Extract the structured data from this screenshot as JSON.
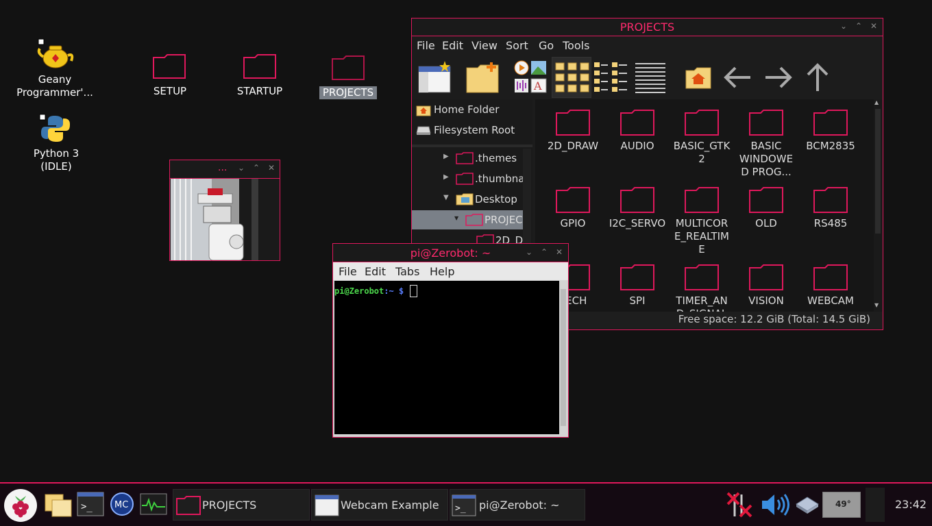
{
  "desktop": {
    "icons": [
      {
        "label": "Geany\nProgrammer'...",
        "icon": "geany-teapot-icon"
      },
      {
        "label": "Python 3\n(IDLE)",
        "icon": "python-icon"
      },
      {
        "label": "SETUP",
        "icon": "folder-icon"
      },
      {
        "label": "STARTUP",
        "icon": "folder-icon"
      },
      {
        "label": "PROJECTS",
        "icon": "folder-icon"
      }
    ]
  },
  "webcam_window": {
    "title": "...",
    "image": "webcam-feed-robot"
  },
  "file_manager": {
    "title": "PROJECTS",
    "menu": [
      "File",
      "Edit",
      "View",
      "Sort",
      "Go",
      "Tools"
    ],
    "toolbar": [
      "new-window-icon",
      "new-folder-icon",
      "thumbnail-view-icon",
      "icon-view-icon",
      "compact-view-icon",
      "detailed-list-icon",
      "home-icon",
      "back-arrow-icon",
      "forward-arrow-icon",
      "up-arrow-icon"
    ],
    "places": [
      {
        "label": "Home Folder",
        "icon": "home-icon"
      },
      {
        "label": "Filesystem Root",
        "icon": "drive-icon"
      }
    ],
    "tree": [
      {
        "label": ".themes",
        "expander": "▶"
      },
      {
        "label": ".thumbna",
        "expander": "▶"
      },
      {
        "label": "Desktop",
        "expander": "▼"
      },
      {
        "label": "PROJEC",
        "expander": "▼"
      },
      {
        "label": "2D_D",
        "expander": ""
      }
    ],
    "items": [
      "2D_DRAW",
      "AUDIO",
      "BASIC_GTK\n2",
      "BASIC\nWINDOWE\nD PROG...",
      "BCM2835",
      "GPIO",
      "I2C_SERVO",
      "MULTICOR\nE_REALTIM\nE",
      "OLD",
      "RS485",
      "EECH",
      "SPI",
      "TIMER_AN\nD_SIGNAL",
      "VISION",
      "WEBCAM"
    ],
    "status": "Free space: 12.2 GiB (Total: 14.5 GiB)"
  },
  "terminal": {
    "title": "pi@Zerobot: ~",
    "menu": [
      "File",
      "Edit",
      "Tabs",
      "Help"
    ],
    "prompt_user": "pi@Zerobot",
    "prompt_path": ":~ $"
  },
  "taskbar": {
    "launchers": [
      "raspberry-menu-icon",
      "file-manager-icon",
      "terminal-icon",
      "mathematica-icon",
      "cpu-monitor-icon"
    ],
    "tasks": [
      {
        "label": "PROJECTS",
        "icon": "folder-icon"
      },
      {
        "label": "Webcam Example",
        "icon": "window-icon"
      },
      {
        "label": "pi@Zerobot: ~",
        "icon": "terminal-icon"
      }
    ],
    "tray": {
      "network": "network-disconnected-icon",
      "volume": "volume-icon",
      "eject": "eject-icon",
      "temperature": "49°",
      "clock": "23:42"
    }
  },
  "colors": {
    "accent": "#e0185c",
    "title": "#ff2a6d",
    "background": "#121212"
  }
}
